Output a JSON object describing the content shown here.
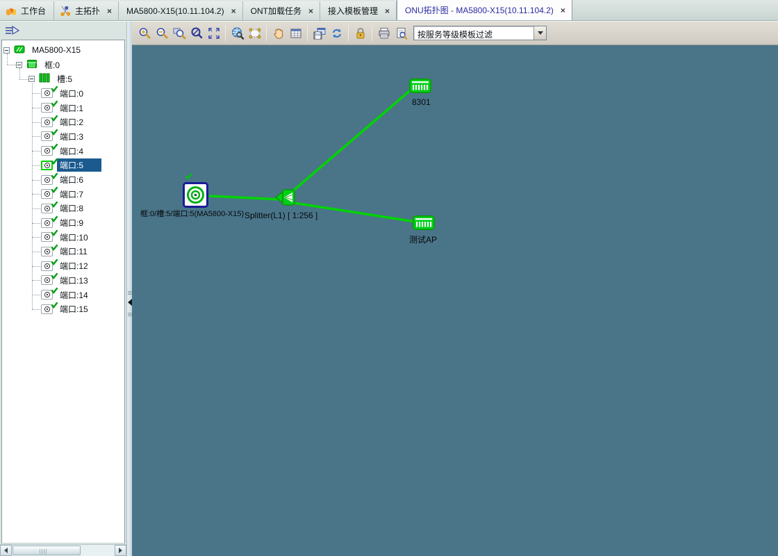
{
  "tabs": [
    {
      "label": "工作台",
      "close": "",
      "icon_class": "tabicon workbench",
      "state_class": ""
    },
    {
      "label": "主拓扑",
      "close": "×",
      "icon_class": "tabicon topology",
      "state_class": ""
    },
    {
      "label": "MA5800-X15(10.11.104.2)",
      "close": "×",
      "icon_class": "tabicon none",
      "state_class": ""
    },
    {
      "label": "ONT加载任务",
      "close": "×",
      "icon_class": "tabicon none",
      "state_class": ""
    },
    {
      "label": "接入模板管理",
      "close": "×",
      "icon_class": "tabicon none",
      "state_class": ""
    },
    {
      "label": "ONU拓扑图 - MA5800-X15(10.11.104.2)",
      "close": "×",
      "icon_class": "tabicon none",
      "state_class": "active"
    }
  ],
  "toolbar": {
    "filter_value": "按服务等级模板过滤",
    "icons": [
      "zoom-in",
      "zoom-out",
      "zoom-region",
      "zoom-reset",
      "fit-view",
      "search",
      "select-region",
      "pan",
      "table-view",
      "save",
      "refresh",
      "lock",
      "print",
      "print-preview"
    ]
  },
  "tree": {
    "root_label": "MA5800-X15",
    "frame_label": "框:0",
    "slot_label": "槽:5",
    "ports": [
      {
        "label": "端口:0",
        "state_class": ""
      },
      {
        "label": "端口:1",
        "state_class": ""
      },
      {
        "label": "端口:2",
        "state_class": ""
      },
      {
        "label": "端口:3",
        "state_class": ""
      },
      {
        "label": "端口:4",
        "state_class": ""
      },
      {
        "label": "端口:5",
        "state_class": "selected"
      },
      {
        "label": "端口:6",
        "state_class": ""
      },
      {
        "label": "端口:7",
        "state_class": ""
      },
      {
        "label": "端口:8",
        "state_class": ""
      },
      {
        "label": "端口:9",
        "state_class": ""
      },
      {
        "label": "端口:10",
        "state_class": ""
      },
      {
        "label": "端口:11",
        "state_class": ""
      },
      {
        "label": "端口:12",
        "state_class": ""
      },
      {
        "label": "端口:13",
        "state_class": ""
      },
      {
        "label": "端口:14",
        "state_class": ""
      },
      {
        "label": "端口:15",
        "state_class": ""
      }
    ]
  },
  "topology": {
    "olt_label": "框:0/槽:5/端口:5(MA5800-X15)",
    "splitter_label": "Splitter(L1) [ 1:256 ]",
    "onu_top": {
      "label": "8301"
    },
    "onu_bottom": {
      "label": "测试AP"
    },
    "colors": {
      "canvas_bg": "#4a7589",
      "link_green": "#00d400",
      "node_green": "#00cf1a",
      "selection_border": "#1b1b96",
      "tree_selected_bg": "#1a5a8f"
    }
  }
}
